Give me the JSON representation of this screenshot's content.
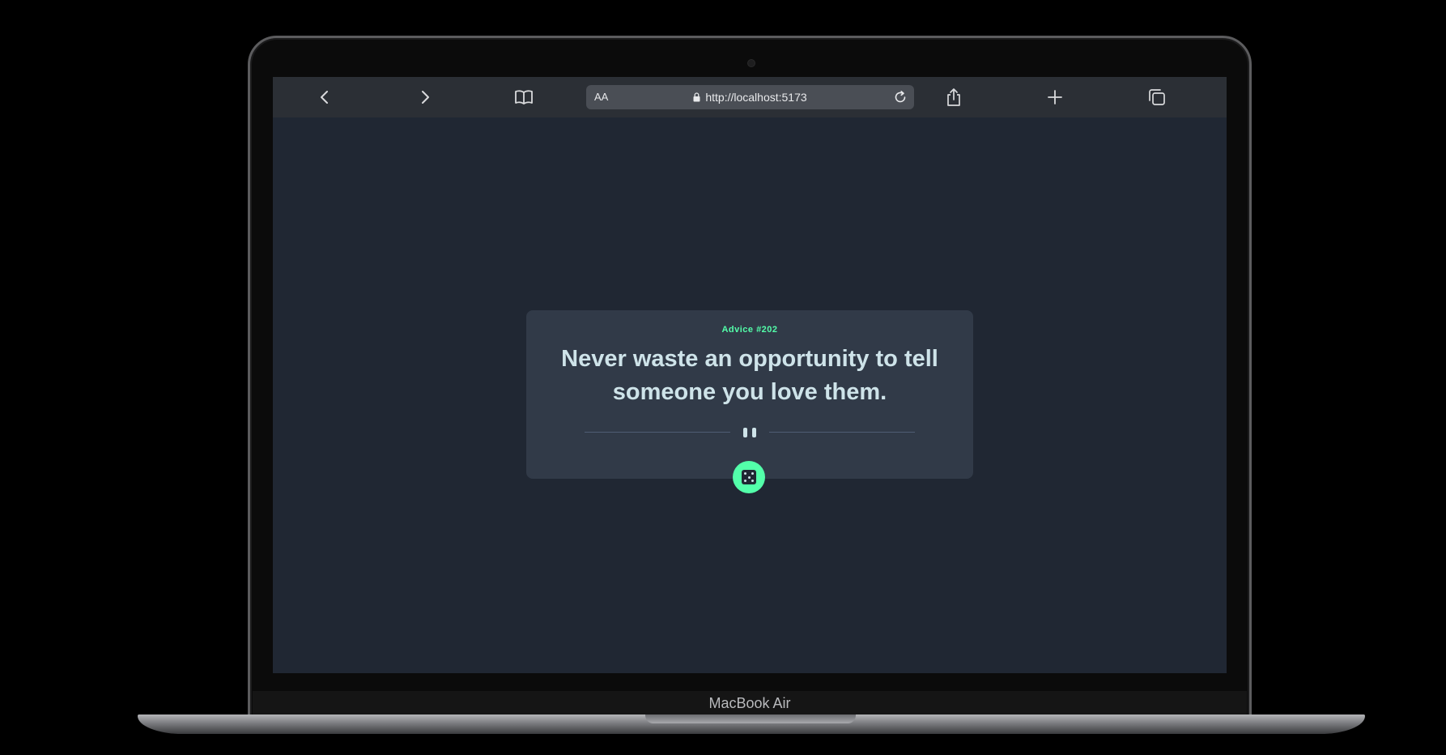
{
  "browser": {
    "url": "http://localhost:5173",
    "text_size_label": "AA"
  },
  "advice": {
    "label": "Advice #202",
    "quote": "Never waste an opportunity to tell someone you love them."
  },
  "device": {
    "model_label": "MacBook Air"
  },
  "colors": {
    "accent": "#53ffaa",
    "card": "#313a48",
    "page_bg": "#202733",
    "quote_text": "#cee3e9"
  }
}
